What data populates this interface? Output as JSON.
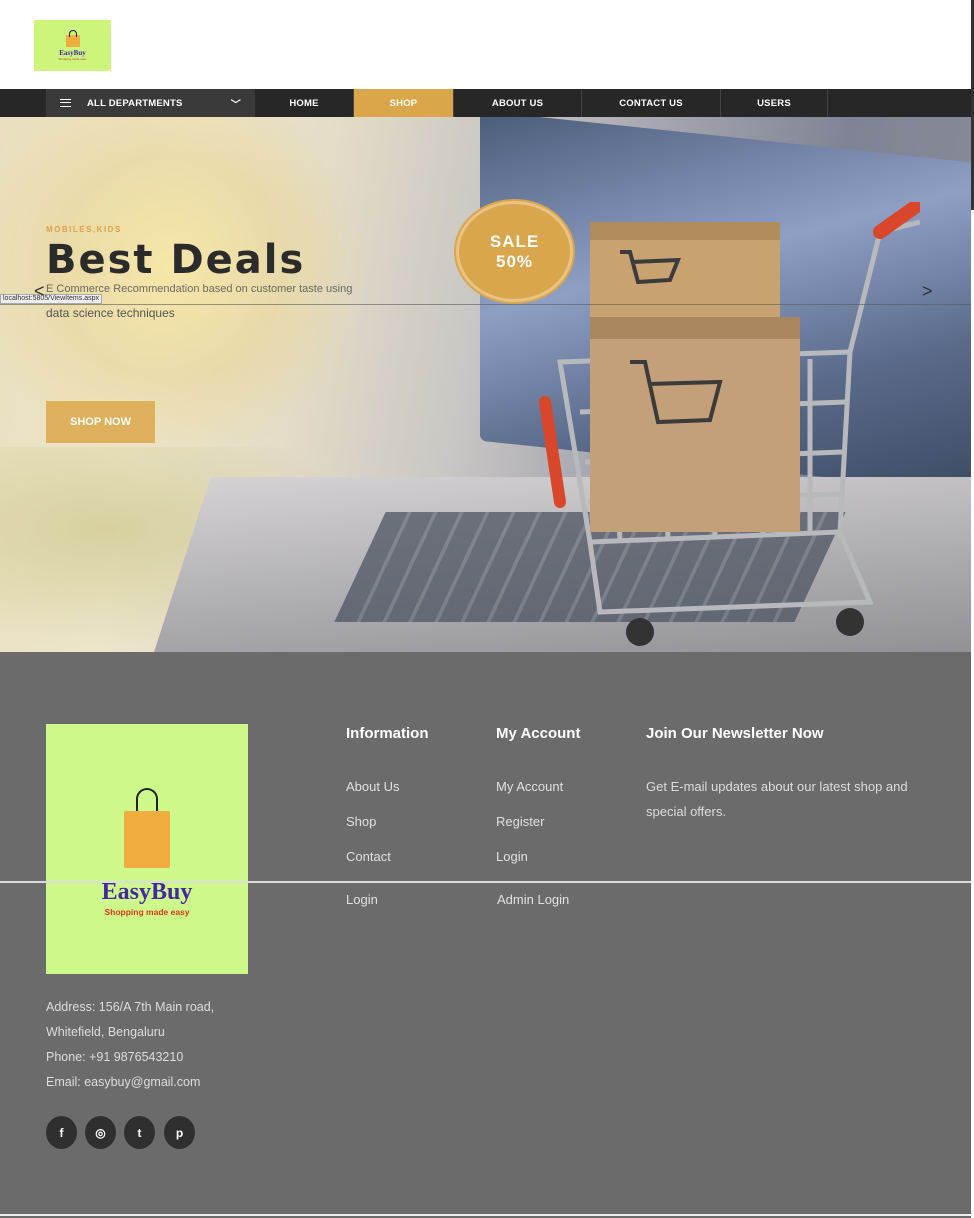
{
  "header": {
    "logo_text": "EasyBuy",
    "logo_tagline": "Shopping made easy"
  },
  "nav": {
    "departments_label": "ALL DEPARTMENTS",
    "items": [
      {
        "label": "HOME"
      },
      {
        "label": "SHOP",
        "active": true
      },
      {
        "label": "ABOUT US"
      },
      {
        "label": "CONTACT US"
      },
      {
        "label": "USERS"
      }
    ]
  },
  "hero": {
    "tag": "MOBILES,KIDS",
    "title": "Best Deals",
    "subtitle_line1": "E Commerce Recommendation based on customer taste using",
    "subtitle_line2": "data science techniques",
    "sale_line1": "SALE",
    "sale_line2": "50%",
    "cta_label": "SHOP NOW",
    "status_url": "localhost:5805/ViewItems.aspx",
    "prev_icon": "chevron-left-icon",
    "next_icon": "chevron-right-icon"
  },
  "footer": {
    "brand": "EasyBuy",
    "brand_tagline": "Shopping made easy",
    "address_line1": "Address: 156/A 7th Main road,",
    "address_line2": "Whitefield, Bengaluru",
    "phone": "Phone: +91 9876543210",
    "email": "Email: easybuy@gmail.com",
    "social": [
      {
        "icon": "facebook-icon",
        "glyph": "f"
      },
      {
        "icon": "instagram-icon",
        "glyph": "◎"
      },
      {
        "icon": "twitter-icon",
        "glyph": "t"
      },
      {
        "icon": "pinterest-icon",
        "glyph": "p"
      }
    ],
    "information": {
      "heading": "Information",
      "links": [
        "About Us",
        "Shop",
        "Contact",
        "Login"
      ]
    },
    "account": {
      "heading": "My Account",
      "links": [
        "My Account",
        "Register",
        "Login",
        "Admin Login"
      ]
    },
    "newsletter": {
      "heading": "Join Our Newsletter Now",
      "text": "Get E-mail updates about our latest shop and special offers."
    }
  },
  "colors": {
    "accent": "#dba64a",
    "nav_bg": "#272727",
    "footer_bg": "#6b6b6b",
    "logo_bg": "#cdf98a"
  }
}
